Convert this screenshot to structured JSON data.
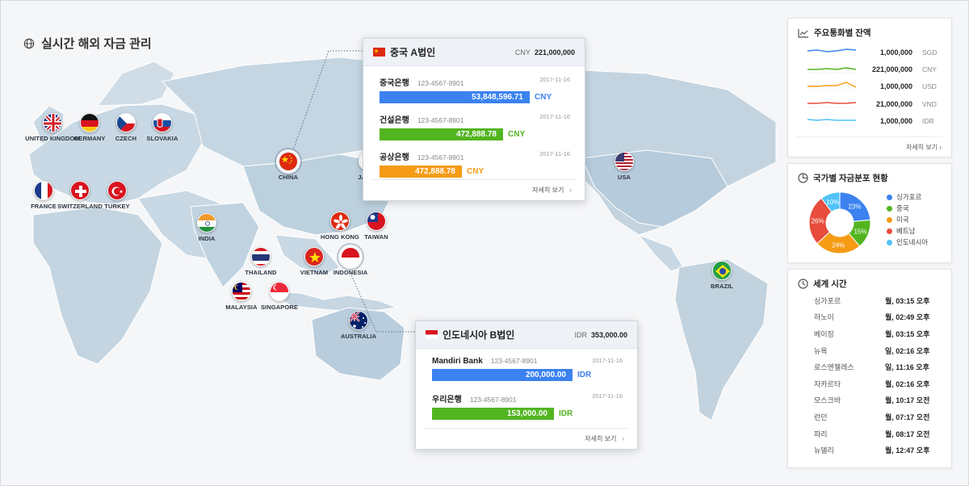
{
  "page_title": "실시간 해외 자금 관리",
  "markers": [
    {
      "label": "UNITED KINGDOM",
      "flag": "uk-flag-icon"
    },
    {
      "label": "GERMANY",
      "flag": "germany-flag-icon"
    },
    {
      "label": "CZECH",
      "flag": "czech-flag-icon"
    },
    {
      "label": "SLOVAKIA",
      "flag": "slovakia-flag-icon"
    },
    {
      "label": "FRANCE",
      "flag": "france-flag-icon"
    },
    {
      "label": "SWITZERLAND",
      "flag": "switzerland-flag-icon"
    },
    {
      "label": "TURKEY",
      "flag": "turkey-flag-icon"
    },
    {
      "label": "INDIA",
      "flag": "india-flag-icon"
    },
    {
      "label": "CHINA",
      "flag": "china-flag-icon"
    },
    {
      "label": "JAPAN",
      "flag": "japan-flag-icon"
    },
    {
      "label": "HONG KONG",
      "flag": "hongkong-flag-icon"
    },
    {
      "label": "TAIWAN",
      "flag": "taiwan-flag-icon"
    },
    {
      "label": "THAILAND",
      "flag": "thailand-flag-icon"
    },
    {
      "label": "VIETNAM",
      "flag": "vietnam-flag-icon"
    },
    {
      "label": "INDONESIA",
      "flag": "indonesia-flag-icon"
    },
    {
      "label": "MALAYSIA",
      "flag": "malaysia-flag-icon"
    },
    {
      "label": "SINGAPORE",
      "flag": "singapore-flag-icon"
    },
    {
      "label": "AUSTRALIA",
      "flag": "australia-flag-icon"
    },
    {
      "label": "USA",
      "flag": "usa-flag-icon"
    },
    {
      "label": "BRAZIL",
      "flag": "brazil-flag-icon"
    }
  ],
  "popup_china": {
    "name": "중국 A법인",
    "currency": "CNY",
    "total": "221,000,000",
    "accounts": [
      {
        "bank": "중국은행",
        "account": "123-4567-8901",
        "date": "2017-11-16",
        "amount": "53,848,596.71",
        "currency": "CNY",
        "color": "#3b82f0",
        "fill": 1.0
      },
      {
        "bank": "건설은행",
        "account": "123-4567-8901",
        "date": "2017-11-16",
        "amount": "472,888.78",
        "currency": "CNY",
        "color": "#52b520",
        "fill": 0.82
      },
      {
        "bank": "공상은행",
        "account": "123-4567-8901",
        "date": "2017-11-16",
        "amount": "472,888.78",
        "currency": "CNY",
        "color": "#f59b14",
        "fill": 0.55
      }
    ],
    "more": "자세히 보기"
  },
  "popup_indonesia": {
    "name": "인도네시아 B법인",
    "currency": "IDR",
    "total": "353,000.00",
    "accounts": [
      {
        "bank": "Mandiri Bank",
        "account": "123-4567-8901",
        "date": "2017-11-16",
        "amount": "200,000.00",
        "currency": "IDR",
        "color": "#3b82f0",
        "fill": 1.0
      },
      {
        "bank": "우리은행",
        "account": "123-4567-8901",
        "date": "2017-11-16",
        "amount": "153,000.00",
        "currency": "IDR",
        "color": "#52b520",
        "fill": 0.87
      }
    ],
    "more": "자세히 보기"
  },
  "balance_panel": {
    "title": "주요통화별 잔액",
    "rows": [
      {
        "amount": "1,000,000",
        "code": "SGD",
        "color": "#3b82f0"
      },
      {
        "amount": "221,000,000",
        "code": "CNY",
        "color": "#52b520"
      },
      {
        "amount": "1,000,000",
        "code": "USD",
        "color": "#f59b14"
      },
      {
        "amount": "21,000,000",
        "code": "VND",
        "color": "#e74c3c"
      },
      {
        "amount": "1,000,000",
        "code": "IDR",
        "color": "#4fc3f7"
      }
    ],
    "more": "자세히 보기"
  },
  "distribution_panel": {
    "title": "국가별 자금분포 현황",
    "chart_data": {
      "type": "pie",
      "categories": [
        "싱가포르",
        "중국",
        "미국",
        "베트남",
        "인도네시아"
      ],
      "values": [
        23,
        15,
        24,
        26,
        10
      ],
      "colors": [
        "#3b82f0",
        "#52b520",
        "#f59b14",
        "#e74c3c",
        "#4fc3f7"
      ]
    },
    "labels": [
      "23%",
      "15%",
      "24%",
      "26%",
      "10%"
    ]
  },
  "time_panel": {
    "title": "세계 시간",
    "rows": [
      {
        "city": "싱가포르",
        "time": "월, 03:15 오후"
      },
      {
        "city": "하노이",
        "time": "월, 02:49 오후"
      },
      {
        "city": "베이징",
        "time": "월, 03:15 오후"
      },
      {
        "city": "뉴욕",
        "time": "일, 02:16 오후"
      },
      {
        "city": "로스엔젤레스",
        "time": "일, 11:16 오후"
      },
      {
        "city": "자카르타",
        "time": "월, 02:16 오후"
      },
      {
        "city": "모스크바",
        "time": "월, 10:17 오전"
      },
      {
        "city": "런던",
        "time": "월, 07:17 오전"
      },
      {
        "city": "파리",
        "time": "월, 08:17 오전"
      },
      {
        "city": "뉴델리",
        "time": "월, 12:47 오후"
      }
    ]
  }
}
